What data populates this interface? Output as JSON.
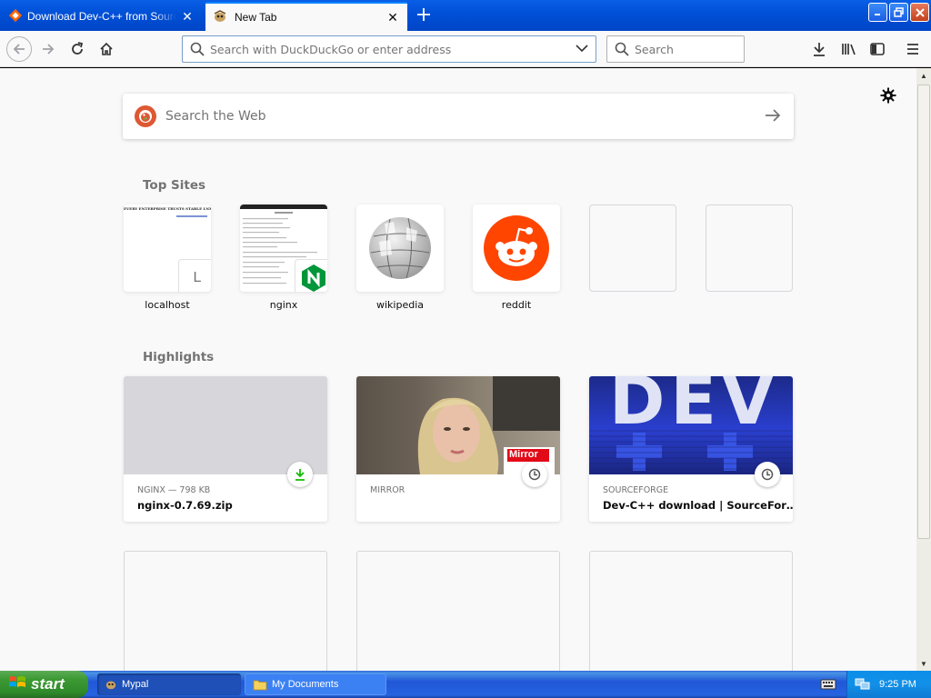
{
  "tabs": [
    {
      "title": "Download Dev-C++ from SourceForge.net",
      "active": false
    },
    {
      "title": "New Tab",
      "active": true
    }
  ],
  "toolbar": {
    "url_placeholder": "Search with DuckDuckGo or enter address",
    "search_placeholder": "Search"
  },
  "newtab": {
    "search_placeholder": "Search the Web",
    "top_sites_title": "Top Sites",
    "highlights_title": "Highlights",
    "top_sites": [
      {
        "label": "localhost",
        "badge": "L"
      },
      {
        "label": "nginx",
        "badge": "N"
      },
      {
        "label": "wikipedia"
      },
      {
        "label": "reddit"
      }
    ],
    "highlights": [
      {
        "source": "NGINX — 798 KB",
        "title": "nginx-0.7.69.zip",
        "icon": "download-icon"
      },
      {
        "source": "MIRROR",
        "title": "",
        "icon": "clock-icon",
        "thumb_text": "Mirror"
      },
      {
        "source": "SOURCEFORGE",
        "title": "Dev-C++ download | SourceFor…",
        "icon": "clock-icon",
        "thumb_text": "DEV"
      }
    ]
  },
  "taskbar": {
    "start_label": "start",
    "tasks": [
      {
        "label": "Mypal",
        "active": true
      },
      {
        "label": "My Documents",
        "active": false
      }
    ],
    "clock": "9:25 PM"
  },
  "colors": {
    "accent": "#0a84ff",
    "reddit": "#ff4500",
    "nginx": "#009639",
    "duckduckgo": "#de5833",
    "xp_blue": "#0054e3",
    "xp_green": "#3c9a34"
  }
}
